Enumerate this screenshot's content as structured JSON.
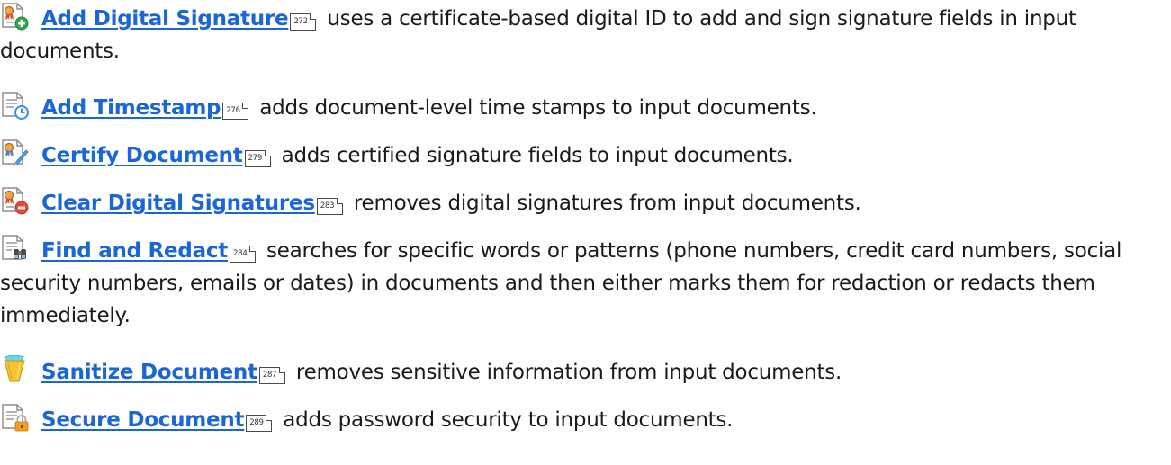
{
  "items": [
    {
      "icon": "add-digital-signature-icon",
      "link": "Add Digital Signature",
      "page": "272",
      "text": "uses a certificate-based digital ID to add and sign signature fields in input documents."
    },
    {
      "icon": "add-timestamp-icon",
      "link": "Add Timestamp",
      "page": "276",
      "text": "adds document-level time stamps to input documents."
    },
    {
      "icon": "certify-document-icon",
      "link": "Certify Document",
      "page": "279",
      "text": "adds certified signature fields to input documents."
    },
    {
      "icon": "clear-digital-signatures-icon",
      "link": "Clear Digital Signatures",
      "page": "283",
      "text": "removes digital signatures from input documents."
    },
    {
      "icon": "find-and-redact-icon",
      "link": "Find and Redact",
      "page": "284",
      "text": "searches for specific words or patterns (phone numbers, credit card numbers, social security numbers, emails or dates) in documents and then either marks them for redaction or redacts them immediately."
    },
    {
      "icon": "sanitize-document-icon",
      "link": "Sanitize Document",
      "page": "287",
      "text": "removes sensitive information from input documents."
    },
    {
      "icon": "secure-document-icon",
      "link": "Secure Document",
      "page": "289",
      "text": "adds password security to input documents."
    }
  ],
  "colors": {
    "link": "#1a66d6",
    "text": "#1a1a1a",
    "add_green": "#35a84a",
    "timestamp_blue": "#3b8ee0",
    "clear_red": "#e24a3b",
    "lock_orange": "#f0a020",
    "sanitize_yellow": "#f3c530",
    "sanitize_cyan": "#6fd6e8"
  }
}
